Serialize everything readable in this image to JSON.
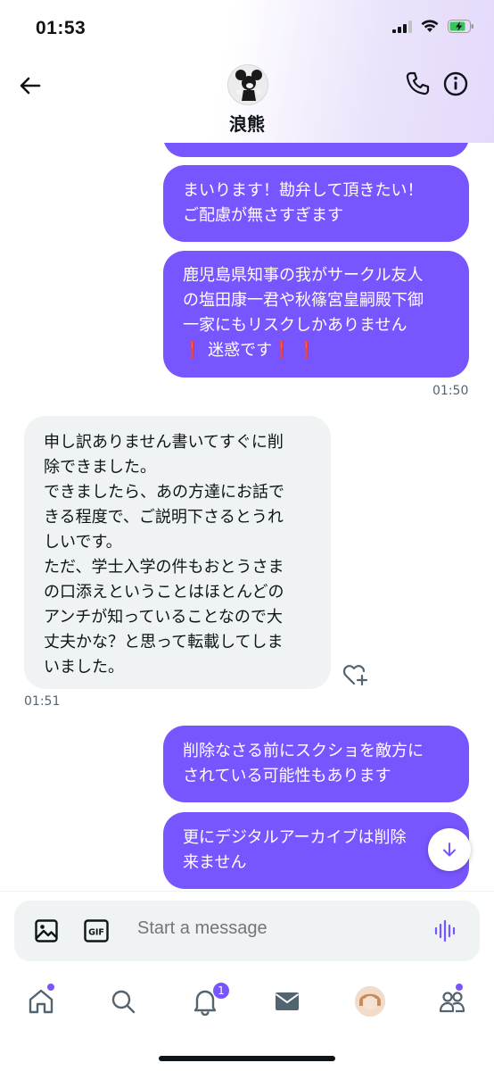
{
  "status_bar": {
    "time": "01:53"
  },
  "header": {
    "contact_name": "浪熊"
  },
  "messages": [
    {
      "id": "m1",
      "lines": [
        "まいります！勘弁して頂きたい！",
        "ご配慮が無さすぎます"
      ]
    },
    {
      "id": "m2",
      "lines": [
        "鹿児島県知事の我がサークル友人",
        "の塩田康一君や秋篠宮皇嗣殿下御",
        "一家にもリスクしかありません",
        "❗ 迷惑です❗ ❗"
      ]
    },
    {
      "id": "m3",
      "lines": [
        "申し訳ありません書いてすぐに削",
        "除できました。",
        "できましたら、あの方達にお話で",
        "きる程度で、ご説明下さるとうれ",
        "しいです。",
        "ただ、学士入学の件もおとうさま",
        "の口添えということはほとんどの",
        "アンチが知っていることなので大",
        "丈夫かな？と思って転載してしま",
        "いました。"
      ]
    },
    {
      "id": "m4",
      "lines": [
        "削除なさる前にスクショを敵方に",
        "されている可能性もあります"
      ]
    },
    {
      "id": "m5",
      "lines": [
        "更にデジタルアーカイブは削除",
        "来ません"
      ]
    }
  ],
  "timestamps": {
    "sent_group_1": "01:50",
    "received_1": "01:51"
  },
  "composer": {
    "placeholder": "Start a message",
    "gif_label": "GIF"
  },
  "tabbar": {
    "notifications_badge": "1"
  },
  "colors": {
    "accent": "#7856ff",
    "received_bubble": "#eff3f4",
    "muted_text": "#536471"
  }
}
